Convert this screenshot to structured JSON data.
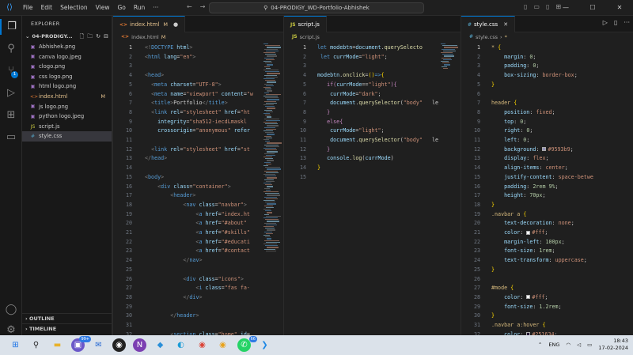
{
  "titlebar": {
    "menu": [
      "File",
      "Edit",
      "Selection",
      "View",
      "Go",
      "Run",
      "···"
    ],
    "search_text": "04-PRODIGY_WD-Portfolio-Abhishek"
  },
  "activity": {
    "source_control_badge": "1"
  },
  "explorer": {
    "title": "EXPLORER",
    "folder": "04-PRODIGY...",
    "files": [
      {
        "name": "Abhishek.png",
        "icon": "image-icon",
        "color": "#a074c4"
      },
      {
        "name": "canva logo.jpeg",
        "icon": "image-icon",
        "color": "#a074c4"
      },
      {
        "name": "clogo.png",
        "icon": "image-icon",
        "color": "#a074c4"
      },
      {
        "name": "css logo.png",
        "icon": "image-icon",
        "color": "#a074c4"
      },
      {
        "name": "html logo.png",
        "icon": "image-icon",
        "color": "#a074c4"
      },
      {
        "name": "index.html",
        "icon": "html-icon",
        "color": "#e37933",
        "mark": "M"
      },
      {
        "name": "js logo.png",
        "icon": "image-icon",
        "color": "#a074c4"
      },
      {
        "name": "python logo.jpeg",
        "icon": "image-icon",
        "color": "#a074c4"
      },
      {
        "name": "script.js",
        "icon": "js-icon",
        "color": "#cbcb41"
      },
      {
        "name": "style.css",
        "icon": "css-icon",
        "color": "#519aba"
      }
    ],
    "outline": "OUTLINE",
    "timeline": "TIMELINE"
  },
  "editor_html": {
    "tab": "index.html",
    "tab_mark": "M",
    "crumb": "index.html",
    "crumb_mark": "M",
    "start_line": 1,
    "current_line": 1
  },
  "editor_js": {
    "tab": "script.js",
    "crumb": "script.js",
    "start_line": 1,
    "current_line": 1
  },
  "editor_css": {
    "tab": "style.css",
    "crumb1": "style.css",
    "crumb2": "*",
    "start_line": 1,
    "current_line": 1
  },
  "taskbar": {
    "badge_1": "99+",
    "badge_2": "66",
    "language": "ENG",
    "time": "18:43",
    "date": "17-02-2024",
    "icons": [
      "start-icon",
      "search-icon",
      "file-manager-icon",
      "meet-icon",
      "mail-icon",
      "app-icon",
      "onenote-icon",
      "photos-icon",
      "edge-icon",
      "chrome-icon",
      "chrome-canary-icon",
      "whatsapp-icon",
      "vscode-icon"
    ]
  }
}
